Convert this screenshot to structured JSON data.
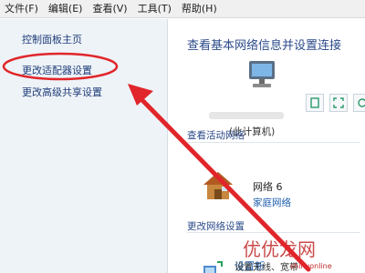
{
  "menu": {
    "items": [
      "文件(F)",
      "编辑(E)",
      "查看(V)",
      "工具(T)",
      "帮助(H)"
    ]
  },
  "sidebar": {
    "links": [
      "控制面板主页",
      "更改适配器设置",
      "更改高级共享设置"
    ]
  },
  "main": {
    "title": "查看基本网络信息并设置连接",
    "this_pc_label": "(此计算机)",
    "active_networks_label": "查看活动网络",
    "network_name": "网络  6",
    "network_type": "家庭网络",
    "change_settings_label": "更改网络设置",
    "new_connection_link": "设置新",
    "new_connection_desc": "设置无线、宽带"
  },
  "watermark": {
    "text": "优优龙网",
    "url": "shinyonline"
  },
  "colors": {
    "annotation_red": "#e0262a",
    "link_blue": "#1f5fb0"
  }
}
